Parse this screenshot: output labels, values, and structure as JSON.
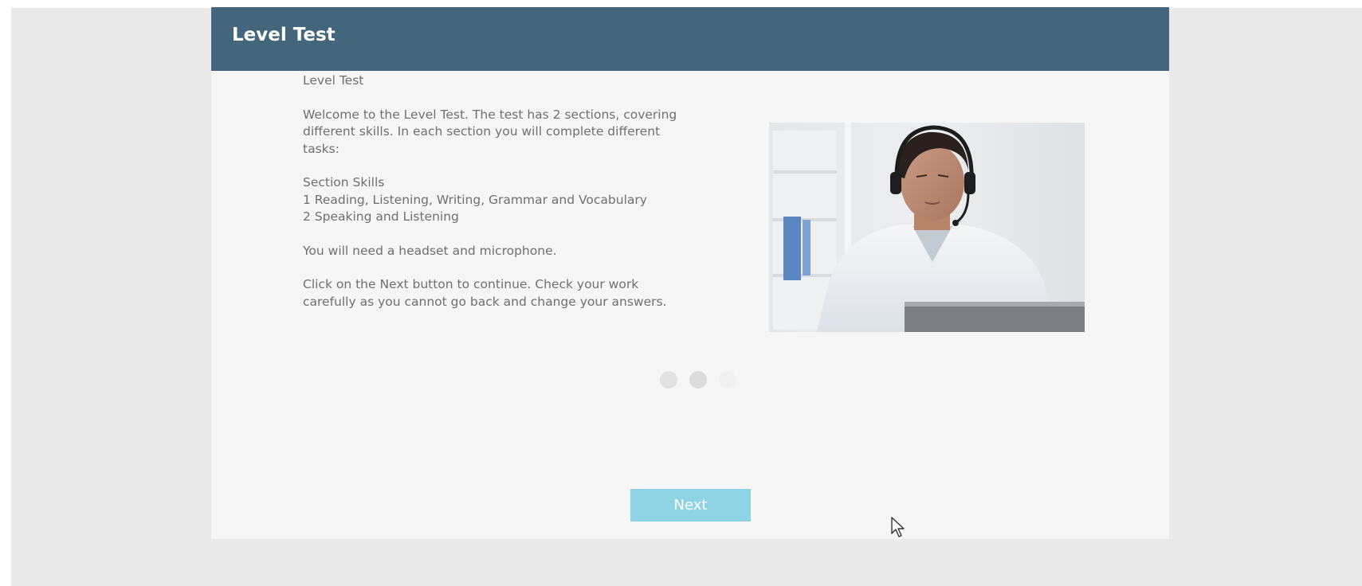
{
  "header": {
    "title": "Level Test"
  },
  "content": {
    "heading": "Level Test",
    "intro_line1": "Welcome to the Level Test. The test has 2 sections, covering",
    "intro_line2": "different skills. In each section you will complete different",
    "intro_line3": "tasks:",
    "sections_header": "Section Skills",
    "section1": "1 Reading, Listening, Writing, Grammar and Vocabulary",
    "section2": "2 Speaking and Listening",
    "equipment": "You will need a headset and microphone.",
    "instructions_line1": "Click on the Next button to continue. Check your work",
    "instructions_line2": "carefully as you cannot go back and change your answers."
  },
  "image": {
    "icon": "person-with-headset-photo"
  },
  "pagination": {
    "count": 3,
    "active_index": 1
  },
  "buttons": {
    "next_label": "Next"
  },
  "colors": {
    "header_bg": "#44667d",
    "next_button_bg": "#8ed4e5",
    "panel_bg": "#f6f6f6",
    "text": "#6f6f6f"
  }
}
